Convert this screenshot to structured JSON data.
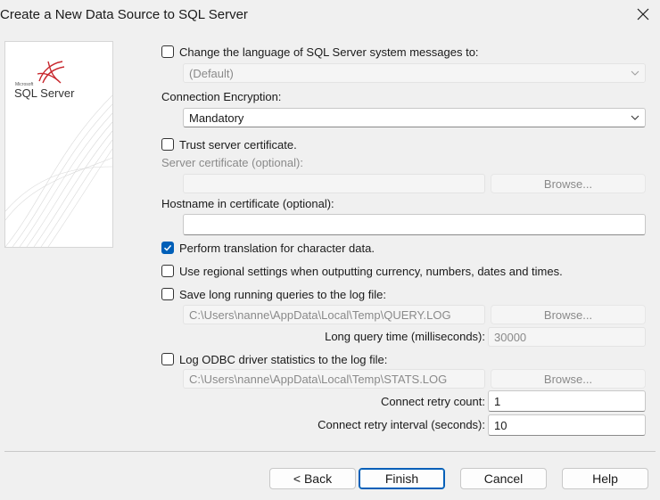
{
  "window": {
    "title": "Create a New Data Source to SQL Server"
  },
  "logo": {
    "brand_small": "Microsoft",
    "brand": "SQL Server"
  },
  "language": {
    "label": "Change the language of SQL Server system messages to:",
    "checked": false,
    "value": "(Default)"
  },
  "encryption": {
    "label": "Connection Encryption:",
    "value": "Mandatory"
  },
  "trust_cert": {
    "label": "Trust server certificate.",
    "checked": false
  },
  "server_cert": {
    "label": "Server certificate (optional):",
    "value": "",
    "browse": "Browse..."
  },
  "hostname": {
    "label": "Hostname in certificate (optional):",
    "value": ""
  },
  "translation": {
    "label": "Perform translation for character data.",
    "checked": true
  },
  "regional": {
    "label": "Use regional settings when outputting currency, numbers, dates and times.",
    "checked": false
  },
  "long_queries": {
    "label": "Save long running queries to the log file:",
    "checked": false,
    "path": "C:\\Users\\nanne\\AppData\\Local\\Temp\\QUERY.LOG",
    "browse": "Browse...",
    "time_label": "Long query time (milliseconds):",
    "time_value": "30000"
  },
  "odbc_stats": {
    "label": "Log ODBC driver statistics to the log file:",
    "checked": false,
    "path": "C:\\Users\\nanne\\AppData\\Local\\Temp\\STATS.LOG",
    "browse": "Browse..."
  },
  "retry": {
    "count_label": "Connect retry count:",
    "count_value": "1",
    "interval_label": "Connect retry interval (seconds):",
    "interval_value": "10"
  },
  "buttons": {
    "back": "< Back",
    "finish": "Finish",
    "cancel": "Cancel",
    "help": "Help"
  },
  "colors": {
    "accent": "#005fb8",
    "logo_red": "#c8262c"
  }
}
